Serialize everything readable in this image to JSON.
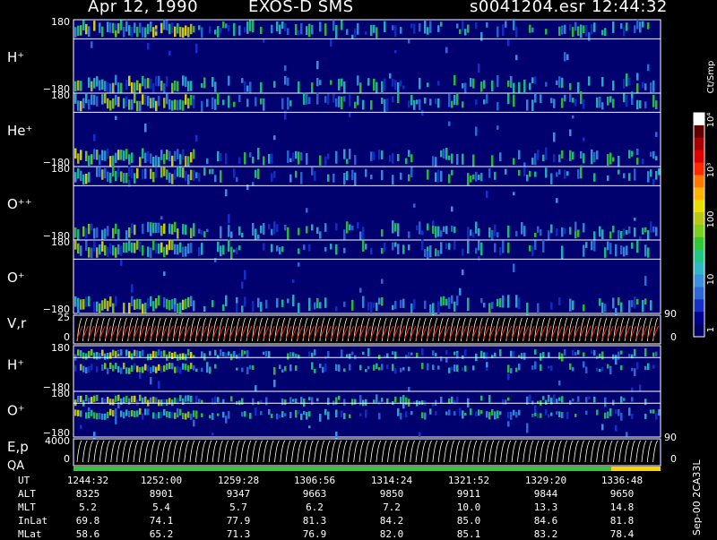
{
  "header": {
    "date": "Apr 12, 1990",
    "mission": "EXOS-D SMS",
    "file": "s0041204.esr",
    "time": "12:44:32"
  },
  "colorbar": {
    "unit": "Ct/Smp",
    "ticks": [
      "1",
      "10",
      "100",
      "10³",
      "10⁴"
    ],
    "colors": [
      "#000064",
      "#00008c",
      "#1430c8",
      "#2c68d8",
      "#3c90e0",
      "#30b8c8",
      "#20c888",
      "#30c838",
      "#7cd020",
      "#b8c818",
      "#e8e000",
      "#ffb400",
      "#ff7800",
      "#ff2800",
      "#e00000",
      "#a80000",
      "#600000",
      "#ffffff"
    ]
  },
  "panels": [
    {
      "label": "H⁺",
      "ymax": "180",
      "ymin": "−180"
    },
    {
      "label": "He⁺",
      "ymax": "180",
      "ymin": "−180"
    },
    {
      "label": "O⁺⁺",
      "ymax": "180",
      "ymin": "−180"
    },
    {
      "label": "O⁺",
      "ymax": "180",
      "ymin": "−180"
    },
    {
      "label": "V,r",
      "ymax": "25",
      "ymid": "0",
      "rmax": "90",
      "rmin": "0"
    },
    {
      "label": "H⁺",
      "ymax": "180",
      "ymin": "−180"
    },
    {
      "label": "O⁺",
      "ymax": "180",
      "ymin": "−180"
    },
    {
      "label": "E,p",
      "label2": "QA",
      "ymax": "4000",
      "ymid": "0",
      "rmax": "90",
      "rmin": "0"
    }
  ],
  "footer": {
    "labels": [
      "UT",
      "ALT",
      "MLT",
      "InLat",
      "MLat"
    ],
    "columns": [
      {
        "UT": "1244:32",
        "ALT": "8325",
        "MLT": "5.2",
        "InLat": "69.8",
        "MLat": "58.6"
      },
      {
        "UT": "1252:00",
        "ALT": "8901",
        "MLT": "5.4",
        "InLat": "74.1",
        "MLat": "65.2"
      },
      {
        "UT": "1259:28",
        "ALT": "9347",
        "MLT": "5.7",
        "InLat": "77.9",
        "MLat": "71.3"
      },
      {
        "UT": "1306:56",
        "ALT": "9663",
        "MLT": "6.2",
        "InLat": "81.3",
        "MLat": "76.9"
      },
      {
        "UT": "1314:24",
        "ALT": "9850",
        "MLT": "7.2",
        "InLat": "84.2",
        "MLat": "82.0"
      },
      {
        "UT": "1321:52",
        "ALT": "9911",
        "MLT": "10.0",
        "InLat": "85.0",
        "MLat": "85.1"
      },
      {
        "UT": "1329:20",
        "ALT": "9844",
        "MLT": "13.3",
        "InLat": "84.6",
        "MLat": "83.2"
      },
      {
        "UT": "1336:48",
        "ALT": "9650",
        "MLT": "14.8",
        "InLat": "81.8",
        "MLat": "78.4"
      }
    ]
  },
  "side_text": "Sep-00  2CA33L",
  "chart_data": {
    "type": "heatmap",
    "title": "Apr 12, 1990   EXOS-D SMS",
    "xlabel": "UT",
    "x_ticks": [
      "1244:32",
      "1252:00",
      "1259:28",
      "1306:56",
      "1314:24",
      "1321:52",
      "1329:20",
      "1336:48"
    ],
    "colorbar_unit": "Ct/Smp",
    "colorbar_ticks": [
      "1",
      "10",
      "100",
      "10³",
      "10⁴"
    ],
    "panel_ranges": [
      {
        "label": "H⁺",
        "ylim": [
          -180,
          180
        ]
      },
      {
        "label": "He⁺",
        "ylim": [
          -180,
          180
        ]
      },
      {
        "label": "O⁺⁺",
        "ylim": [
          -180,
          180
        ]
      },
      {
        "label": "O⁺",
        "ylim": [
          -180,
          180
        ]
      },
      {
        "label": "V,r",
        "ylim": [
          0,
          25
        ],
        "y2lim": [
          0,
          90
        ]
      },
      {
        "label": "H⁺",
        "ylim": [
          -180,
          180
        ]
      },
      {
        "label": "O⁺",
        "ylim": [
          -180,
          180
        ]
      },
      {
        "label": "E,p",
        "ylim": [
          0,
          4000
        ],
        "y2lim": [
          0,
          90
        ]
      }
    ]
  }
}
